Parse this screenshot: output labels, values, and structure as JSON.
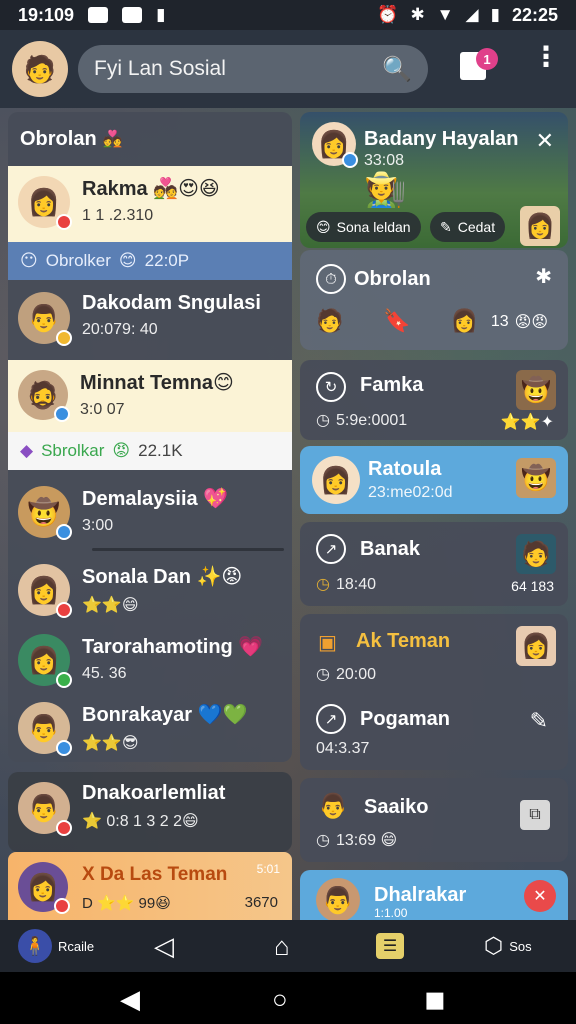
{
  "status_bar": {
    "time_left": "19:109",
    "time_right": "22:25"
  },
  "app_bar": {
    "search_text": "Fyi Lan Sosial",
    "notification_count": "1",
    "menu_icon": "more-vert-icon"
  },
  "left_panel": {
    "title": "Obrolan",
    "title_emoji": "💑",
    "rows": [
      {
        "name": "Rakma",
        "emoji": "💑😍😆",
        "sub": "1 1 .2.310"
      },
      {
        "name": "Dakodam Sngulasi",
        "emoji": "",
        "sub": "20:079: 40"
      },
      {
        "name": "Minnat Temna",
        "emoji": "😊",
        "sub": "3:0 07"
      },
      {
        "name": "Demalaysiia",
        "emoji": "💖",
        "sub": "3:00"
      },
      {
        "name": "Sonala Dan",
        "emoji": "✨😡",
        "sub": "⭐⭐😄"
      },
      {
        "name": "Tarorahamoting",
        "emoji": "💗",
        "sub": "45. 36"
      },
      {
        "name": "Bonrakayar",
        "emoji": "💙💚",
        "sub": "⭐⭐😎"
      }
    ],
    "strip_blue": {
      "label": "Obrolker",
      "emoji": "😊",
      "value": "22:0P"
    },
    "strip_white": {
      "label": "Sbrolkar",
      "emoji": "😡",
      "value": "22.1K"
    }
  },
  "lower_left": {
    "name": "Dnakoarlemliat",
    "sub": "⭐ 0:8 1 3 2 2😄"
  },
  "orange_card": {
    "title": "X Da Las Teman",
    "corner": "5:01",
    "sub": "D ⭐⭐ 99😆",
    "value": "3670"
  },
  "right": {
    "top_card": {
      "name": "Badany Hayalan",
      "sub": "33:08",
      "pill1": "Sona leldan",
      "pill2": "Cedat"
    },
    "obro_card": {
      "title": "Obrolan",
      "count": "13"
    },
    "cards": [
      {
        "name": "Famka",
        "sub": "5:9e:0001"
      },
      {
        "name": "Ratoula",
        "sub": "23:me02:0d"
      },
      {
        "name": "Banak",
        "sub": "18:40",
        "extra": "64 183"
      },
      {
        "name": "Ak Teman",
        "sub": "20:00"
      },
      {
        "name": "Pogaman",
        "sub": "04:3.37"
      },
      {
        "name": "Saaiko",
        "sub": "13:69"
      },
      {
        "name": "Dhalrakar",
        "sub": "1:1.00"
      }
    ]
  },
  "bottom_nav": {
    "item1": "Rcaile",
    "item5": "Sos"
  },
  "colors": {
    "accent_blue": "#5da9dc",
    "cream": "#fbf3d6",
    "orange": "#f7b46a",
    "badge_pink": "#e0408a"
  }
}
